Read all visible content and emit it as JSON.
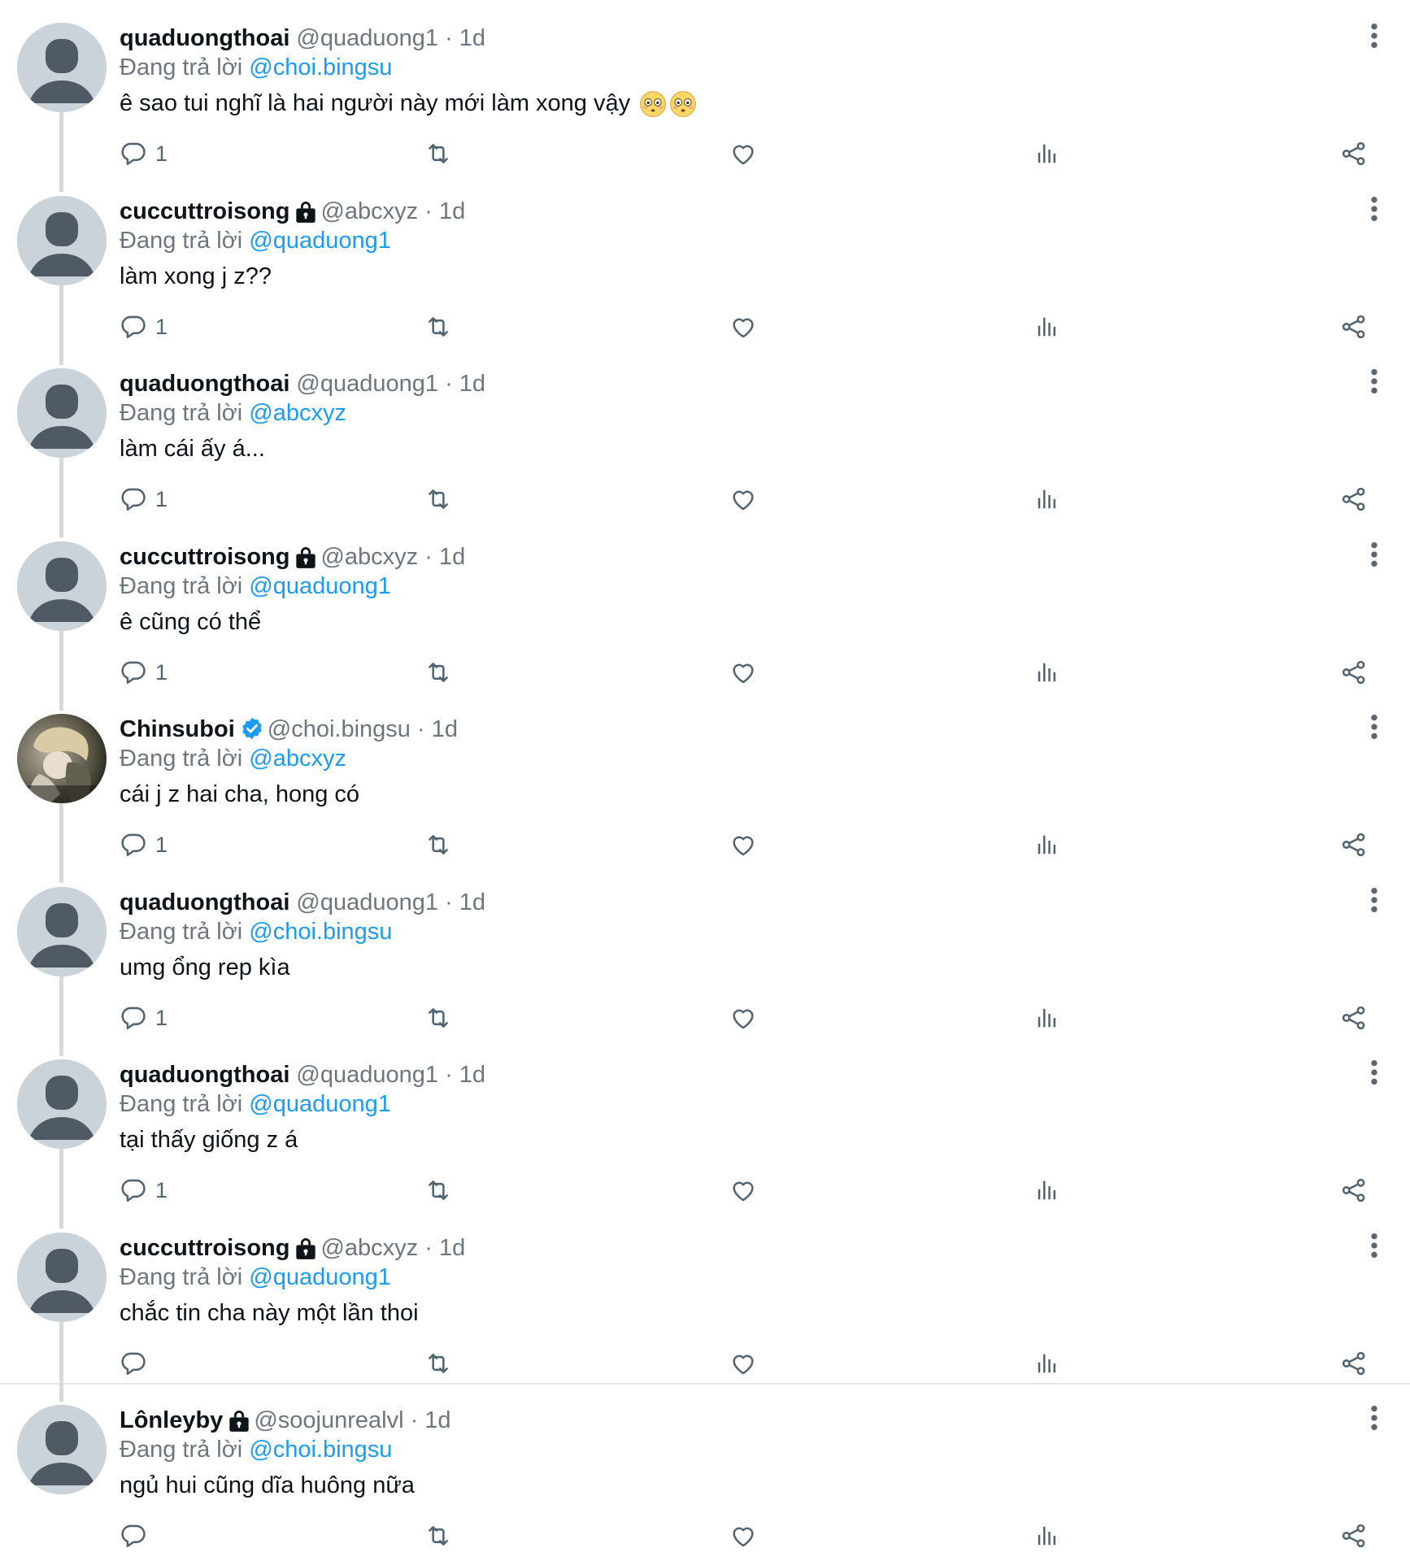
{
  "colors": {
    "accent": "#1d9bf0",
    "muted": "#6e767d",
    "text": "#0f1419",
    "thread_line": "#d5dade"
  },
  "icons": {
    "reply": "reply-icon",
    "retweet": "retweet-icon",
    "like": "heart-icon",
    "views": "views-icon",
    "share": "share-icon",
    "more": "more-vertical-icon",
    "lock": "lock-icon",
    "verified": "verified-icon",
    "emoji": "flushed-emoji"
  },
  "tweets": [
    {
      "name": "quaduongthoai",
      "handle": "@quaduong1",
      "time": "· 1d",
      "reply_prefix": "Đang trả lời",
      "reply_to": "@choi.bingsu",
      "text": "ê sao tui nghĩ là hai người này mới làm xong vậy",
      "reply_count": "1",
      "badge": "",
      "emoji": true,
      "avatar": "default"
    },
    {
      "name": "cuccuttroisong",
      "handle": "@abcxyz",
      "time": "· 1d",
      "reply_prefix": "Đang trả lời",
      "reply_to": "@quaduong1",
      "text": "làm xong j z??",
      "reply_count": "1",
      "badge": "lock",
      "emoji": false,
      "avatar": "default"
    },
    {
      "name": "quaduongthoai",
      "handle": "@quaduong1",
      "time": "· 1d",
      "reply_prefix": "Đang trả lời",
      "reply_to": "@abcxyz",
      "text": "làm cái ấy á...",
      "reply_count": "1",
      "badge": "",
      "emoji": false,
      "avatar": "default"
    },
    {
      "name": "cuccuttroisong",
      "handle": "@abcxyz",
      "time": "· 1d",
      "reply_prefix": "Đang trả lời",
      "reply_to": "@quaduong1",
      "text": "ê cũng có thể",
      "reply_count": "1",
      "badge": "lock",
      "emoji": false,
      "avatar": "default"
    },
    {
      "name": "Chinsuboi",
      "handle": "@choi.bingsu",
      "time": "· 1d",
      "reply_prefix": "Đang trả lời",
      "reply_to": "@abcxyz",
      "text": "cái j z hai cha, hong có",
      "reply_count": "1",
      "badge": "verified",
      "emoji": false,
      "avatar": "photo"
    },
    {
      "name": "quaduongthoai",
      "handle": "@quaduong1",
      "time": "· 1d",
      "reply_prefix": "Đang trả lời",
      "reply_to": "@choi.bingsu",
      "text": "umg ổng rep kìa",
      "reply_count": "1",
      "badge": "",
      "emoji": false,
      "avatar": "default"
    },
    {
      "name": "quaduongthoai",
      "handle": "@quaduong1",
      "time": "· 1d",
      "reply_prefix": "Đang trả lời",
      "reply_to": "@quaduong1",
      "text": "tại thấy giống z á",
      "reply_count": "1",
      "badge": "",
      "emoji": false,
      "avatar": "default"
    },
    {
      "name": "cuccuttroisong",
      "handle": "@abcxyz",
      "time": "· 1d",
      "reply_prefix": "Đang trả lời",
      "reply_to": "@quaduong1",
      "text": "chắc tin cha này một lần thoi",
      "reply_count": "",
      "badge": "lock",
      "emoji": false,
      "avatar": "default"
    },
    {
      "name": "Lônleyby",
      "handle": "@soojunrealvl",
      "time": "· 1d",
      "reply_prefix": "Đang trả lời",
      "reply_to": "@choi.bingsu",
      "text": "ngủ hui cũng dĩa huông nữa",
      "reply_count": "",
      "badge": "lock",
      "emoji": false,
      "avatar": "default"
    }
  ]
}
